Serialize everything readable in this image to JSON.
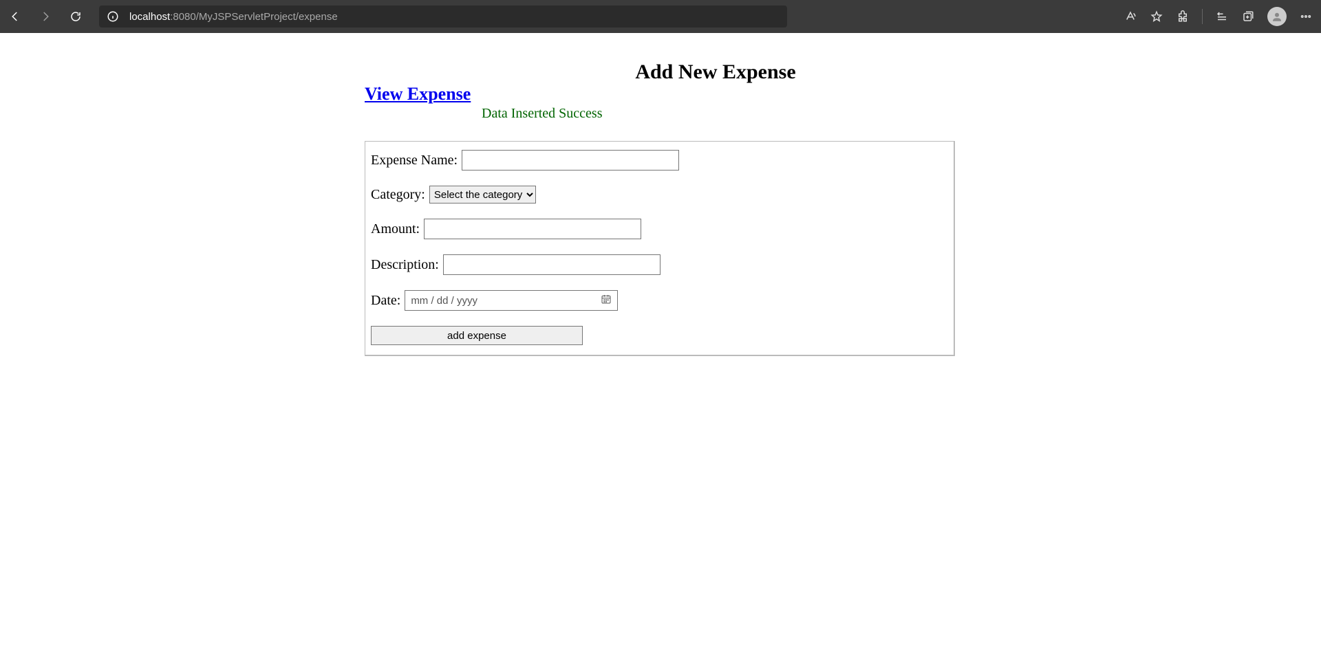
{
  "browser": {
    "url_host": "localhost",
    "url_port_path": ":8080/MyJSPServletProject/expense"
  },
  "page": {
    "title": "Add New Expense",
    "view_link": "View Expense",
    "status": "Data Inserted Success"
  },
  "form": {
    "expense_name_label": "Expense Name:",
    "expense_name_value": "",
    "category_label": "Category:",
    "category_selected": "Select the category",
    "amount_label": "Amount:",
    "amount_value": "",
    "description_label": "Description:",
    "description_value": "",
    "date_label": "Date:",
    "date_placeholder": "mm / dd / yyyy",
    "submit_label": "add expense"
  }
}
